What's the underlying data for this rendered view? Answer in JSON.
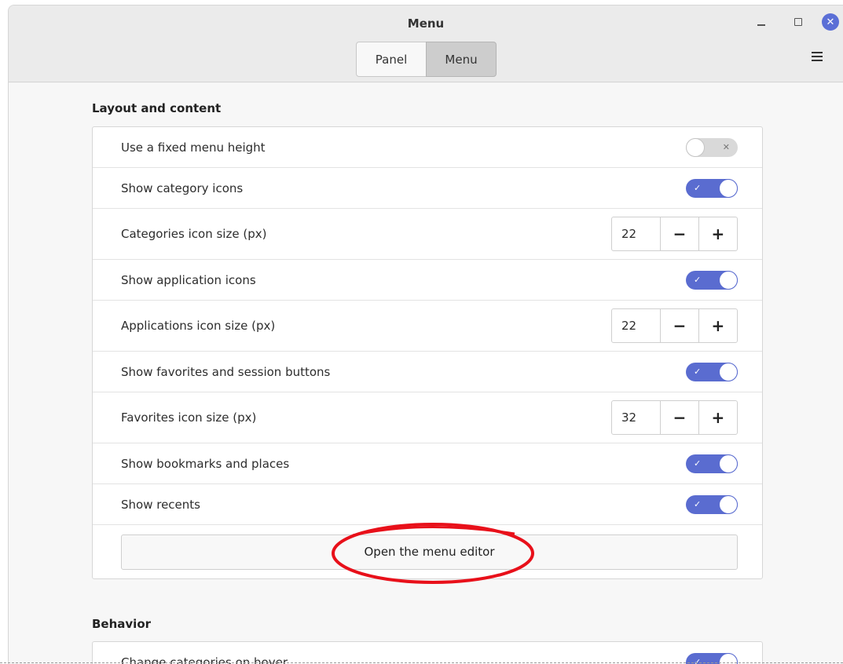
{
  "window": {
    "title": "Menu"
  },
  "tabs": [
    {
      "label": "Panel"
    },
    {
      "label": "Menu"
    }
  ],
  "sections": {
    "layout": {
      "title": "Layout and content",
      "fixed_height": {
        "label": "Use a fixed menu height",
        "enabled": false
      },
      "category_icons": {
        "label": "Show category icons",
        "enabled": true
      },
      "categories_icon_size": {
        "label": "Categories icon size (px)",
        "value": "22"
      },
      "application_icons": {
        "label": "Show application icons",
        "enabled": true
      },
      "applications_icon_size": {
        "label": "Applications icon size (px)",
        "value": "22"
      },
      "favorites_session": {
        "label": "Show favorites and session buttons",
        "enabled": true
      },
      "favorites_icon_size": {
        "label": "Favorites icon size (px)",
        "value": "32"
      },
      "bookmarks_places": {
        "label": "Show bookmarks and places",
        "enabled": true
      },
      "recents": {
        "label": "Show recents",
        "enabled": true
      },
      "menu_editor": {
        "label": "Open the menu editor"
      }
    },
    "behavior": {
      "title": "Behavior",
      "change_on_hover": {
        "label": "Change categories on hover",
        "enabled": true
      }
    }
  },
  "glyphs": {
    "minus": "−",
    "plus": "+",
    "check": "✓",
    "cross": "✕"
  },
  "colors": {
    "accent": "#5a6cd0",
    "annotation": "#e8101a"
  }
}
